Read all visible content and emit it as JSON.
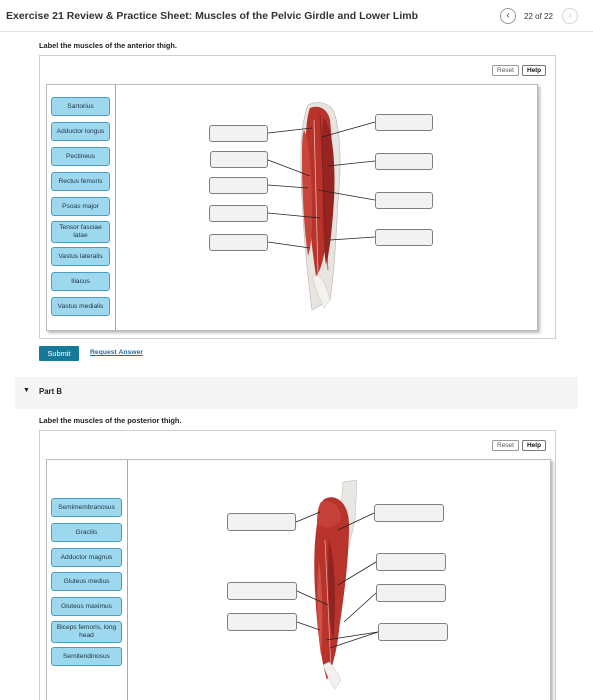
{
  "header": {
    "title": "Exercise 21 Review & Practice Sheet: Muscles of the Pelvic Girdle and Lower Limb",
    "page_counter": "22 of 22",
    "prev_icon": "‹",
    "next_icon": "›"
  },
  "part_a": {
    "instruction": "Label the muscles of the anterior thigh.",
    "reset_label": "Reset",
    "help_label": "Help",
    "labels": [
      "Sartorius",
      "Adductor longus",
      "Pectineus",
      "Rectus femoris",
      "Psoas major",
      "Tensor fasciae latae",
      "Vastus lateralis",
      "Iliacus",
      "Vastus medialis"
    ],
    "submit_label": "Submit",
    "request_answer_label": "Request Answer"
  },
  "part_b": {
    "title": "Part B",
    "caret": "▼",
    "instruction": "Label the muscles of the posterior thigh.",
    "reset_label": "Reset",
    "help_label": "Help",
    "labels": [
      "Semimembranosus",
      "Gracilis",
      "Adductor magnus",
      "Gluteus medius",
      "Gluteus maximus",
      "Biceps femoris, long head",
      "Semitendinosus"
    ]
  },
  "colors": {
    "chip_fill": "#9dd8ee",
    "chip_border": "#4a9fc0",
    "submit_fill": "#157a9a",
    "link": "#1f6da6",
    "muscle_red": "#b8332b"
  }
}
